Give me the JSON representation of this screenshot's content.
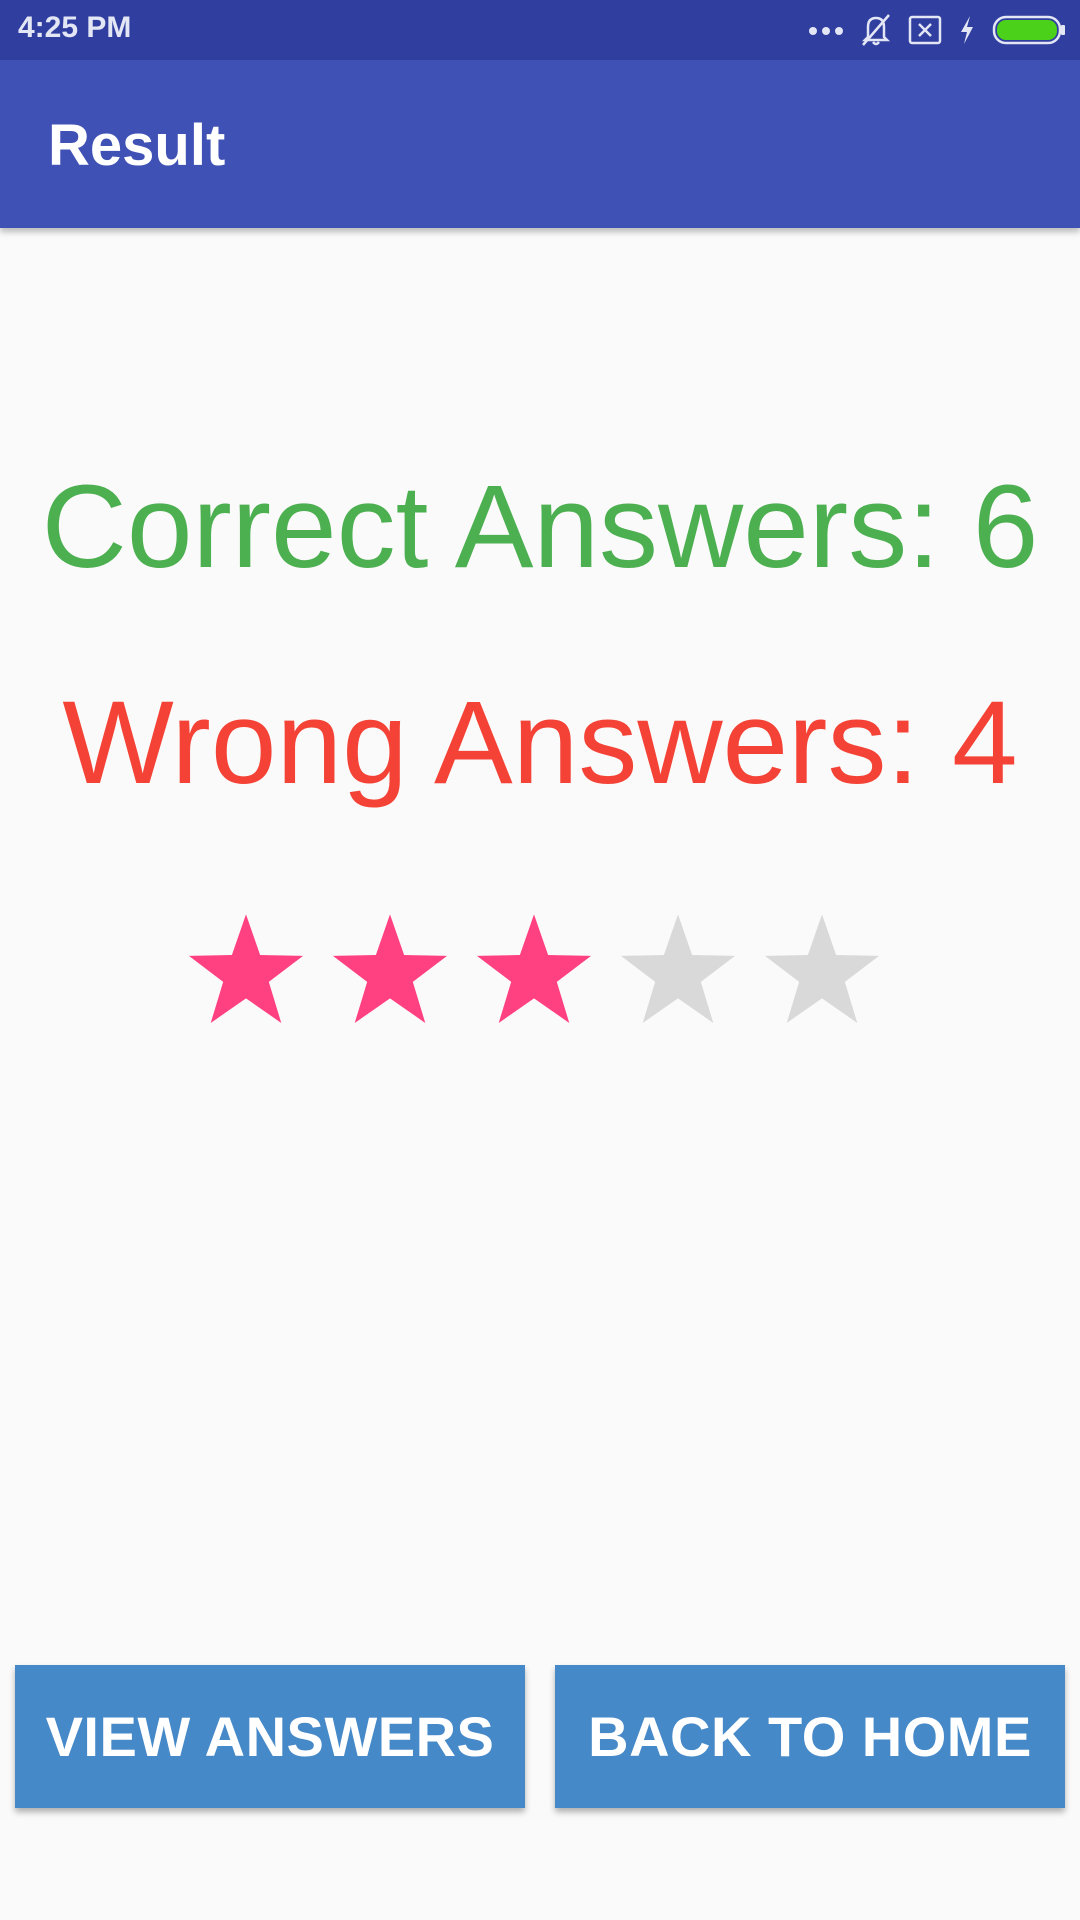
{
  "status_bar": {
    "time": "4:25 PM",
    "icons": [
      "more-dots-icon",
      "bell-off-icon",
      "sim-error-icon",
      "charging-bolt-icon",
      "battery-icon"
    ],
    "battery_color": "#4CD11A"
  },
  "app_bar": {
    "title": "Result",
    "color": "#3F51B5"
  },
  "results": {
    "correct_text": "Correct Answers: 6",
    "correct_color": "#4CAF50",
    "wrong_text": "Wrong Answers: 4",
    "wrong_color": "#F44336"
  },
  "rating": {
    "value": 3,
    "max": 5,
    "filled_color": "#FF4081",
    "empty_color": "#D9D9D9"
  },
  "buttons": {
    "view_answers": "VIEW ANSWERS",
    "back_to_home": "BACK TO HOME",
    "color": "#4589C8"
  }
}
